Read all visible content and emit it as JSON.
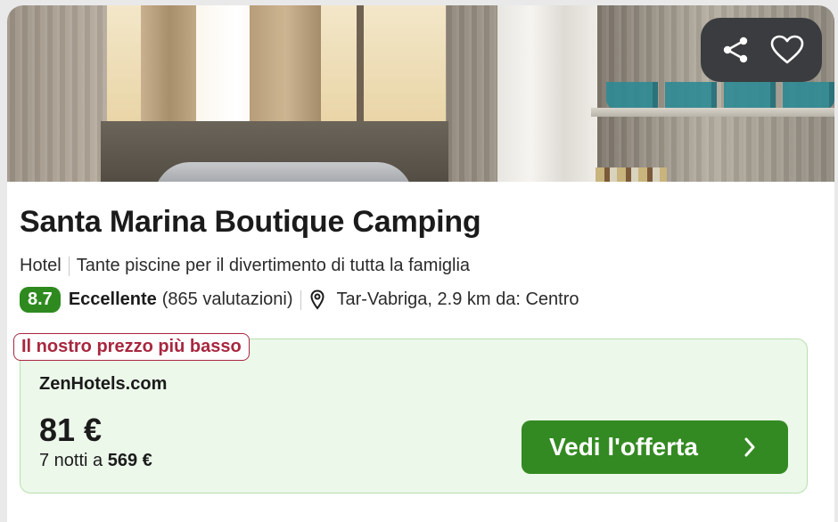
{
  "hotel": {
    "name": "Santa Marina Boutique Camping",
    "type": "Hotel",
    "tagline": "Tante piscine per il divertimento di tutta la famiglia",
    "score": "8.7",
    "rating_label": "Eccellente",
    "reviews": "(865 valutazioni)",
    "location": "Tar-Vabriga, 2.9 km da: Centro"
  },
  "actions": {
    "share_icon": "share-icon",
    "favorite_icon": "heart-icon"
  },
  "offer": {
    "badge": "Il nostro prezzo più basso",
    "provider": "ZenHotels.com",
    "price": "81 €",
    "nights_prefix": "7 notti a ",
    "total": "569 €",
    "cta_label": "Vedi l'offerta"
  },
  "colors": {
    "score_bg": "#2e8a1f",
    "cta_bg": "#348a22",
    "badge": "#a8273f",
    "offer_bg": "#ecf8ea"
  }
}
